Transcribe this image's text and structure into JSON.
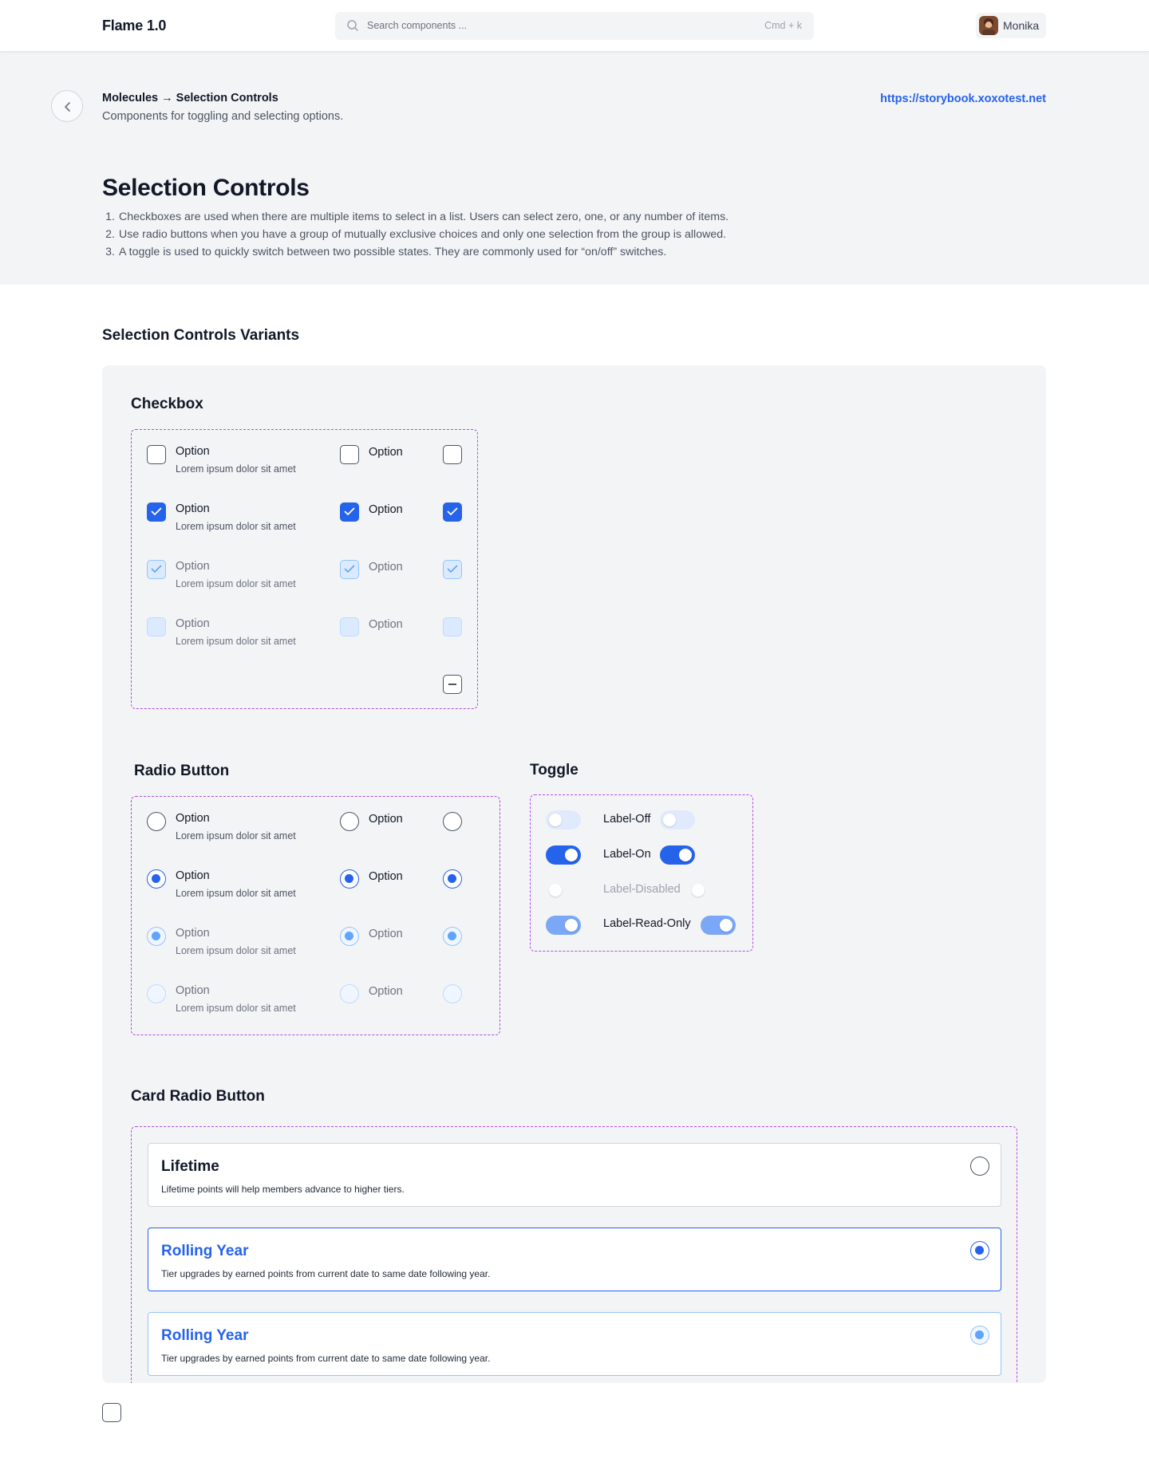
{
  "app": {
    "brand": "Flame 1.0"
  },
  "search": {
    "placeholder": "Search components ...",
    "shortcut": "Cmd + k"
  },
  "user": {
    "name": "Monika"
  },
  "header": {
    "breadcrumb": "Molecules → Selection Controls",
    "subtitle": "Components for toggling and selecting options.",
    "link": "https://storybook.xoxotest.net"
  },
  "page": {
    "title": "Selection Controls",
    "intro": [
      {
        "num": "1.",
        "text": "Checkboxes are used when there are multiple items to select in a list. Users can select zero, one, or any number of items."
      },
      {
        "num": "2.",
        "text": "Use radio buttons when you have a group of mutually exclusive choices and only one selection from the group is allowed."
      },
      {
        "num": "3.",
        "text": "A toggle is used to quickly switch between two possible states. They are commonly used for “on/off” switches."
      }
    ]
  },
  "variants": {
    "title": "Selection Controls Variants",
    "checkbox": {
      "title": "Checkbox",
      "option_label": "Option",
      "option_desc": "Lorem ipsum dolor sit amet",
      "rows": [
        "default",
        "checked",
        "read-only",
        "disabled"
      ],
      "extra": "indeterminate"
    },
    "radio": {
      "title": "Radio Button",
      "option_label": "Option",
      "option_desc": "Lorem ipsum dolor sit amet",
      "rows": [
        "default",
        "checked",
        "read-only",
        "disabled"
      ]
    },
    "toggle": {
      "title": "Toggle",
      "rows": [
        {
          "label": "Label-Off",
          "state": "off"
        },
        {
          "label": "Label-On",
          "state": "on"
        },
        {
          "label": "Label-Disabled",
          "state": "disabled"
        },
        {
          "label": "Label-Read-Only",
          "state": "read-only"
        }
      ]
    },
    "card_radio": {
      "title": "Card Radio Button",
      "cards": [
        {
          "title": "Lifetime",
          "desc": "Lifetime points will help members advance to higher tiers.",
          "state": "default"
        },
        {
          "title": "Rolling Year",
          "desc": "Tier upgrades by earned points from current date to same date following year.",
          "state": "selected"
        },
        {
          "title": "Rolling Year",
          "desc": "Tier upgrades by earned points from current date to same date following year.",
          "state": "read-only"
        }
      ]
    }
  },
  "colors": {
    "accent": "#2563eb",
    "frame": "#b14ee0",
    "panel": "#f3f4f6"
  },
  "icons": [
    "search-icon",
    "chevron-left-icon",
    "check-icon",
    "minus-icon"
  ]
}
